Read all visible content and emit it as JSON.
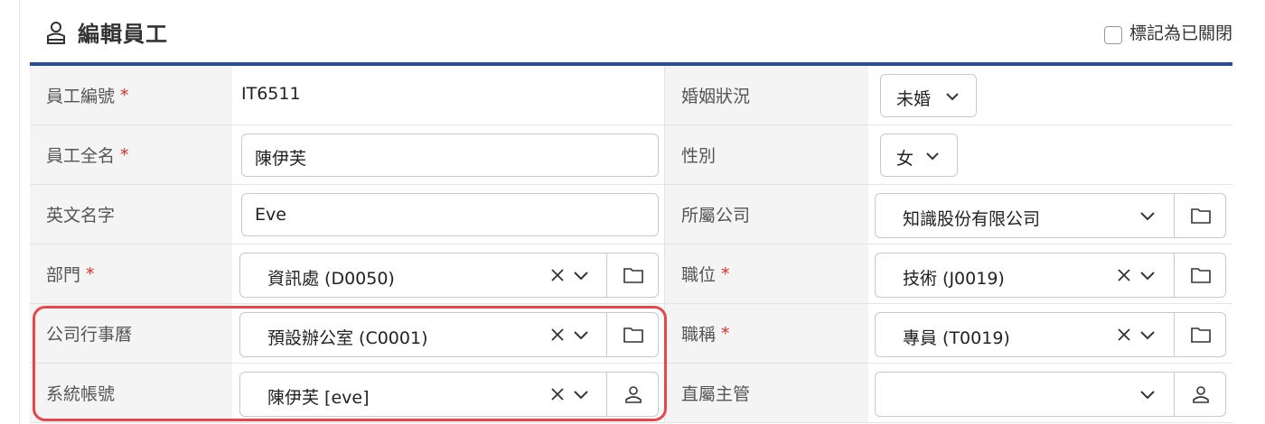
{
  "header": {
    "title": "編輯員工",
    "title_icon": "user-badge-icon",
    "mark_closed_label": "標記為已關閉",
    "mark_closed_checked": false
  },
  "required_mark": "*",
  "colors": {
    "accent_bar": "#264d99",
    "required": "#d9302c",
    "highlight": "#e8464b",
    "label_bg": "#f4f4f4"
  },
  "fields": {
    "employee_id": {
      "label": "員工編號",
      "value": "IT6511"
    },
    "full_name": {
      "label": "員工全名",
      "value": "陳伊芙"
    },
    "english_name": {
      "label": "英文名字",
      "value": "Eve"
    },
    "department": {
      "label": "部門",
      "value": "資訊處 (D0050)"
    },
    "company_calendar": {
      "label": "公司行事曆",
      "value": "預設辦公室 (C0001)"
    },
    "system_account": {
      "label": "系統帳號",
      "value": "陳伊芙 [eve]"
    },
    "marital_status": {
      "label": "婚姻狀況",
      "value": "未婚"
    },
    "gender": {
      "label": "性別",
      "value": "女"
    },
    "company": {
      "label": "所屬公司",
      "value": "知識股份有限公司"
    },
    "position": {
      "label": "職位",
      "value": "技術 (J0019)"
    },
    "job_title": {
      "label": "職稱",
      "value": "專員 (T0019)"
    },
    "supervisor": {
      "label": "直屬主管",
      "value": ""
    }
  }
}
